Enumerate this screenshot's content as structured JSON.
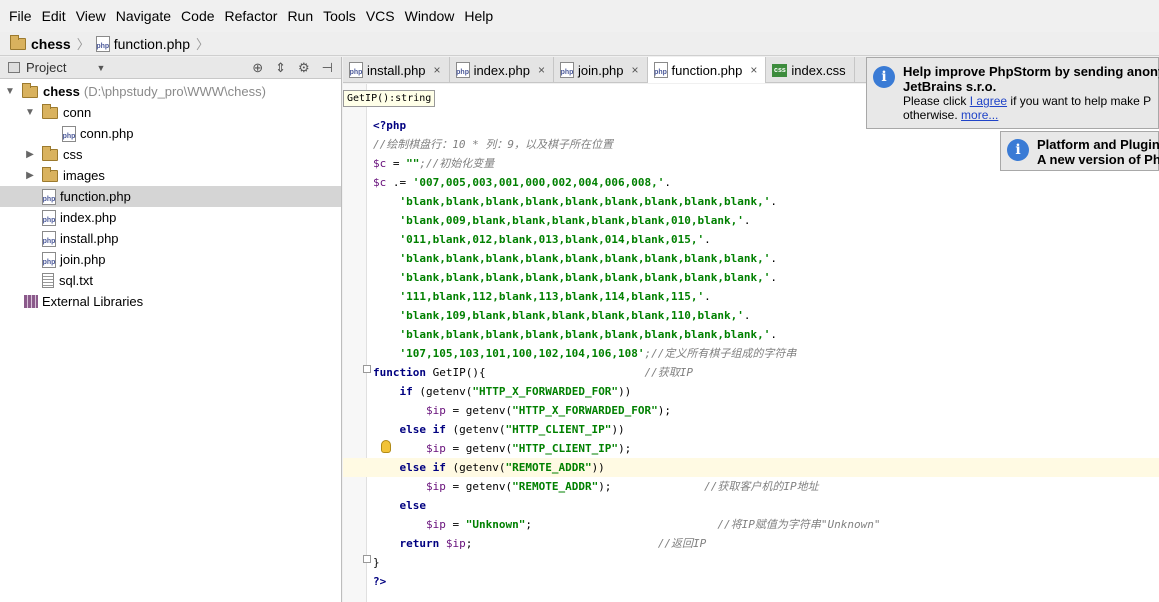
{
  "menu": [
    "File",
    "Edit",
    "View",
    "Navigate",
    "Code",
    "Refactor",
    "Run",
    "Tools",
    "VCS",
    "Window",
    "Help"
  ],
  "breadcrumb": {
    "project": "chess",
    "file": "function.php"
  },
  "project_panel": {
    "title": "Project",
    "tree": [
      {
        "label": "chess",
        "hint": "(D:\\phpstudy_pro\\WWW\\chess)",
        "type": "folder",
        "level": 0,
        "expanded": true
      },
      {
        "label": "conn",
        "type": "folder",
        "level": 1,
        "expanded": true
      },
      {
        "label": "conn.php",
        "type": "php",
        "level": 2
      },
      {
        "label": "css",
        "type": "folder",
        "level": 1,
        "expanded": false
      },
      {
        "label": "images",
        "type": "folder",
        "level": 1,
        "expanded": false
      },
      {
        "label": "function.php",
        "type": "php",
        "level": 1,
        "selected": true
      },
      {
        "label": "index.php",
        "type": "php",
        "level": 1
      },
      {
        "label": "install.php",
        "type": "php",
        "level": 1
      },
      {
        "label": "join.php",
        "type": "php",
        "level": 1
      },
      {
        "label": "sql.txt",
        "type": "txt",
        "level": 1
      },
      {
        "label": "External Libraries",
        "type": "lib",
        "level": 0
      }
    ]
  },
  "tabs": [
    {
      "label": "install.php",
      "type": "php"
    },
    {
      "label": "index.php",
      "type": "php"
    },
    {
      "label": "join.php",
      "type": "php"
    },
    {
      "label": "function.php",
      "type": "php",
      "active": true
    },
    {
      "label": "index.css",
      "type": "css"
    }
  ],
  "editor": {
    "tooltip": "GetIP():string",
    "lines": [
      [
        [
          "tag",
          "<?php"
        ]
      ],
      [
        [
          "cmt",
          "//绘制棋盘行：10 * 列：9，以及棋子所在位置"
        ]
      ],
      [
        [
          "var",
          "$c"
        ],
        [
          "",
          " = "
        ],
        [
          "str",
          "\"\""
        ],
        [
          "cmt",
          ";//初始化变量"
        ]
      ],
      [
        [
          "var",
          "$c"
        ],
        [
          "",
          " .= "
        ],
        [
          "str",
          "'007,005,003,001,000,002,004,006,008,'"
        ],
        [
          "",
          "."
        ]
      ],
      [
        [
          "",
          "    "
        ],
        [
          "str",
          "'blank,blank,blank,blank,blank,blank,blank,blank,blank,'"
        ],
        [
          "",
          "."
        ]
      ],
      [
        [
          "",
          "    "
        ],
        [
          "str",
          "'blank,009,blank,blank,blank,blank,blank,010,blank,'"
        ],
        [
          "",
          "."
        ]
      ],
      [
        [
          "",
          "    "
        ],
        [
          "str",
          "'011,blank,012,blank,013,blank,014,blank,015,'"
        ],
        [
          "",
          "."
        ]
      ],
      [
        [
          "",
          "    "
        ],
        [
          "str",
          "'blank,blank,blank,blank,blank,blank,blank,blank,blank,'"
        ],
        [
          "",
          "."
        ]
      ],
      [
        [
          "",
          "    "
        ],
        [
          "str",
          "'blank,blank,blank,blank,blank,blank,blank,blank,blank,'"
        ],
        [
          "",
          "."
        ]
      ],
      [
        [
          "",
          "    "
        ],
        [
          "str",
          "'111,blank,112,blank,113,blank,114,blank,115,'"
        ],
        [
          "",
          "."
        ]
      ],
      [
        [
          "",
          "    "
        ],
        [
          "str",
          "'blank,109,blank,blank,blank,blank,blank,110,blank,'"
        ],
        [
          "",
          "."
        ]
      ],
      [
        [
          "",
          "    "
        ],
        [
          "str",
          "'blank,blank,blank,blank,blank,blank,blank,blank,blank,'"
        ],
        [
          "",
          "."
        ]
      ],
      [
        [
          "",
          "    "
        ],
        [
          "str",
          "'107,105,103,101,100,102,104,106,108'"
        ],
        [
          "cmt",
          ";//定义所有棋子组成的字符串"
        ]
      ],
      [
        [
          "kw",
          "function"
        ],
        [
          "",
          " GetIP(){                        "
        ],
        [
          "cmt",
          "//获取IP"
        ]
      ],
      [
        [
          "",
          "    "
        ],
        [
          "kw",
          "if"
        ],
        [
          "",
          " (getenv("
        ],
        [
          "str",
          "\"HTTP_X_FORWARDED_FOR\""
        ],
        [
          "",
          "))"
        ]
      ],
      [
        [
          "",
          "        "
        ],
        [
          "var",
          "$ip"
        ],
        [
          "",
          " = getenv("
        ],
        [
          "str",
          "\"HTTP_X_FORWARDED_FOR\""
        ],
        [
          "",
          ");"
        ]
      ],
      [
        [
          "",
          "    "
        ],
        [
          "kw",
          "else if"
        ],
        [
          "",
          " (getenv("
        ],
        [
          "str",
          "\"HTTP_CLIENT_IP\""
        ],
        [
          "",
          "))"
        ]
      ],
      [
        [
          "",
          "        "
        ],
        [
          "var",
          "$ip"
        ],
        [
          "",
          " = getenv("
        ],
        [
          "str",
          "\"HTTP_CLIENT_IP\""
        ],
        [
          "",
          ");"
        ]
      ],
      [
        [
          "",
          "    "
        ],
        [
          "kw",
          "else if"
        ],
        [
          "",
          " (getenv("
        ],
        [
          "str",
          "\"REMOTE_ADDR\""
        ],
        [
          "",
          "))"
        ]
      ],
      [
        [
          "",
          "        "
        ],
        [
          "var",
          "$ip"
        ],
        [
          "",
          " = getenv("
        ],
        [
          "str",
          "\"REMOTE_ADDR\""
        ],
        [
          "",
          ");              "
        ],
        [
          "cmt",
          "//获取客户机的IP地址"
        ]
      ],
      [
        [
          "",
          "    "
        ],
        [
          "kw",
          "else"
        ]
      ],
      [
        [
          "",
          "        "
        ],
        [
          "var",
          "$ip"
        ],
        [
          "",
          " = "
        ],
        [
          "str",
          "\"Unknown\""
        ],
        [
          "",
          ";                            "
        ],
        [
          "cmt",
          "//将IP赋值为字符串\"Unknown\""
        ]
      ],
      [
        [
          "",
          "    "
        ],
        [
          "kw",
          "return"
        ],
        [
          "",
          " "
        ],
        [
          "var",
          "$ip"
        ],
        [
          "",
          ";                            "
        ],
        [
          "cmt",
          "//返回IP"
        ]
      ],
      [
        [
          "",
          "}"
        ]
      ],
      [
        [
          "tag",
          "?>"
        ]
      ]
    ]
  },
  "notifications": [
    {
      "title": "Help improve PhpStorm by sending anony",
      "title2": "JetBrains s.r.o.",
      "text_before": "Please click ",
      "link1": "I agree",
      "text_after": " if you want to help make P",
      "text2": "otherwise. ",
      "link2": "more..."
    },
    {
      "title": "Platform and Plugin",
      "title2": "A new version of Ph"
    }
  ]
}
